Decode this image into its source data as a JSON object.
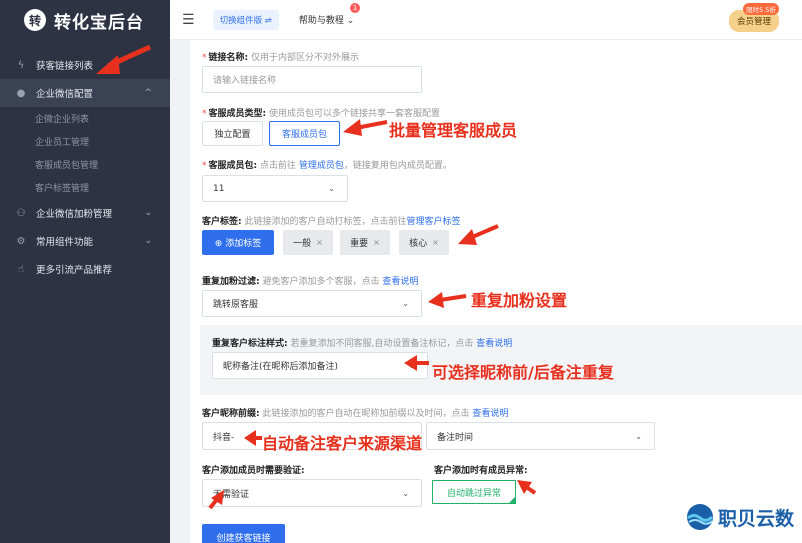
{
  "sidebar": {
    "logo_glyph": "转",
    "logo_text": "转化宝后台",
    "items": [
      {
        "label": "获客链接列表",
        "icon": "lightning-icon"
      },
      {
        "label": "企业微信配置",
        "icon": "chat-icon",
        "expanded": true
      },
      {
        "label": "企业微信加粉管理",
        "icon": "users-icon"
      },
      {
        "label": "常用组件功能",
        "icon": "gear-icon"
      },
      {
        "label": "更多引流产品推荐",
        "icon": "thumbs-up-icon"
      }
    ],
    "subitems": [
      "企微企业列表",
      "企业员工管理",
      "客服成员包管理",
      "客户标签管理"
    ]
  },
  "header": {
    "switch_label": "切换组件版 ⇌",
    "help_label": "帮助与教程",
    "help_badge": "1",
    "member_label": "会员管理",
    "member_tag": "限时5.5折"
  },
  "form": {
    "link_name_label": "链接名称:",
    "link_name_hint": "仅用于内部区分不对外展示",
    "link_name_placeholder": "请输入链接名称",
    "service_type_label": "客服成员类型:",
    "service_type_hint": "使用成员包可以多个链接共享一套客服配置",
    "type_independent": "独立配置",
    "type_package": "客服成员包",
    "member_pkg_label": "客服成员包:",
    "member_pkg_hint_a": "点击前往",
    "member_pkg_link": "管理成员包",
    "member_pkg_hint_b": "，链接复用包内成员配置。",
    "member_pkg_value": "11",
    "tags_label": "客户标签:",
    "tags_hint": "此链接添加的客户自动打标签，点击前往",
    "tags_link": "管理客户标签",
    "add_tag": "⊕ 添加标签",
    "tags": [
      "一般",
      "重要",
      "核心"
    ],
    "tag_remove": "×",
    "dup_filter_label": "重复加粉过滤:",
    "dup_filter_hint": "避免客户添加多个客服，点击",
    "dup_filter_link": "查看说明",
    "dup_filter_value": "跳转原客服",
    "dup_style_label": "重复客户标注样式:",
    "dup_style_hint": "若重复添加不同客服,自动设置备注标记，点击",
    "dup_style_link": "查看说明",
    "dup_style_value": "昵称备注(在昵称后添加备注)",
    "nick_prefix_label": "客户昵称前缀:",
    "nick_prefix_hint": "此链接添加的客户自动在昵称加前缀以及时间，点击",
    "nick_prefix_link": "查看说明",
    "nick_prefix_value": "抖音-",
    "nick_time_value": "备注时间",
    "verify_label": "客户添加成员时需要验证:",
    "verify_value": "无需验证",
    "abnormal_label": "客户添加时有成员异常:",
    "abnormal_value": "自动跳过异常",
    "create_button": "创建获客链接"
  },
  "annotations": {
    "batch": "批量管理客服成员",
    "dup": "重复加粉设置",
    "nick": "可选择昵称前/后备注重复",
    "source": "自动备注客户来源渠道"
  },
  "watermark": {
    "text": "职贝云数",
    "icon": "globe-logo-icon"
  },
  "colors": {
    "sidebar": "#2d3342",
    "accent": "#2f6fed",
    "annotation": "#e8301e",
    "success": "#20b26b"
  }
}
